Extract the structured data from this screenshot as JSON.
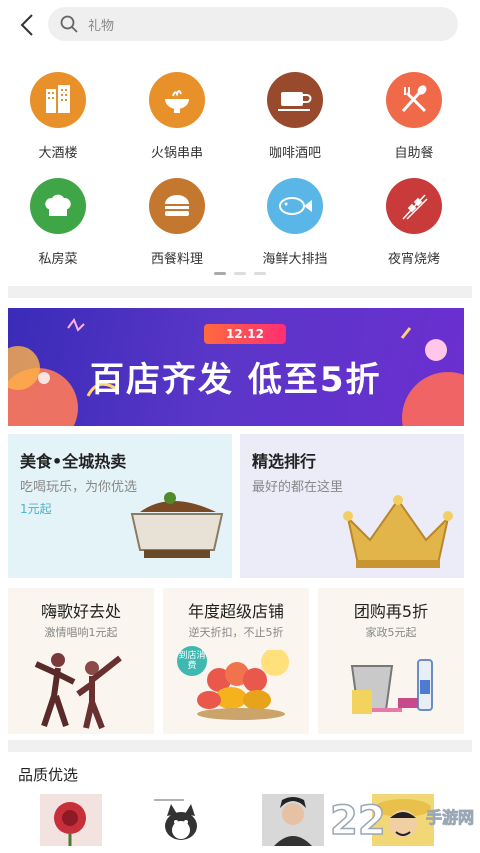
{
  "header": {
    "search_placeholder": "礼物"
  },
  "categories": [
    {
      "label": "大酒楼",
      "color": "#e8902a",
      "icon": "building-icon"
    },
    {
      "label": "火锅串串",
      "color": "#e8902a",
      "icon": "hotpot-icon"
    },
    {
      "label": "咖啡酒吧",
      "color": "#9a4a2c",
      "icon": "coffee-icon"
    },
    {
      "label": "自助餐",
      "color": "#f06a4a",
      "icon": "fork-spoon-icon"
    },
    {
      "label": "私房菜",
      "color": "#3ea646",
      "icon": "chef-hat-icon"
    },
    {
      "label": "西餐料理",
      "color": "#c4772e",
      "icon": "burger-icon"
    },
    {
      "label": "海鲜大排挡",
      "color": "#5ab6e6",
      "icon": "fish-icon"
    },
    {
      "label": "夜宵烧烤",
      "color": "#c93a3a",
      "icon": "skewer-icon"
    }
  ],
  "banner": {
    "tag": "12.12",
    "headline": "百店齐发  低至5折"
  },
  "feature_cards": [
    {
      "title": "美食•全城热卖",
      "subtitle": "吃喝玩乐，为你优选",
      "extra": "1元起"
    },
    {
      "title": "精选排行",
      "subtitle": "最好的都在这里"
    }
  ],
  "mini_cards": [
    {
      "title": "嗨歌好去处",
      "subtitle": "激情唱响1元起"
    },
    {
      "title": "年度超级店铺",
      "subtitle": "逆天折扣，不止5折",
      "badge": "到店消费"
    },
    {
      "title": "团购再5折",
      "subtitle": "家政5元起"
    }
  ],
  "section": {
    "title": "品质优选"
  },
  "watermark": {
    "number": "22",
    "text": "手游网"
  }
}
